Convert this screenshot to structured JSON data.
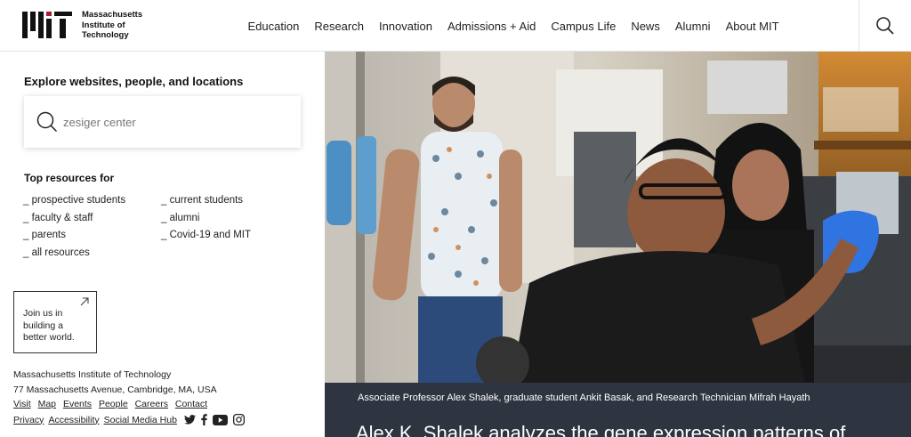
{
  "header": {
    "logo_lines": [
      "Massachusetts",
      "Institute of",
      "Technology"
    ],
    "nav": [
      "Education",
      "Research",
      "Innovation",
      "Admissions + Aid",
      "Campus Life",
      "News",
      "Alumni",
      "About MIT"
    ],
    "search_icon": "search-icon"
  },
  "left": {
    "explore_title": "Explore websites, people, and locations",
    "search_placeholder": "zesiger center",
    "top_resources_title": "Top resources for",
    "resources_col1": [
      "_ prospective students",
      "_ faculty & staff",
      "_ parents",
      "_ all resources"
    ],
    "resources_col2": [
      "_ current students",
      "_ alumni",
      "_ Covid-19 and MIT"
    ],
    "join_text": [
      "Join us in",
      "building a",
      "better world."
    ],
    "join_icon": "arrow-up-right-icon",
    "institute_name": "Massachusetts Institute of Technology",
    "address": "77 Massachusetts Avenue, Cambridge, MA, USA",
    "links_row1": [
      "Visit",
      "Map",
      "Events",
      "People",
      "Careers",
      "Contact"
    ],
    "links_row2": [
      "Privacy",
      "Accessibility",
      "Social Media Hub"
    ],
    "social_icons": [
      "twitter-icon",
      "facebook-icon",
      "youtube-icon",
      "instagram-icon"
    ]
  },
  "hero": {
    "caption_small": "Associate Professor Alex Shalek, graduate student Ankit Basak, and Research Technician Mifrah Hayath",
    "caption_big": "Alex K. Shalek analyzes the gene expression patterns of"
  },
  "colors": {
    "caption_bg": "#2e3440",
    "text": "#222222",
    "border": "#e2e2e2"
  }
}
